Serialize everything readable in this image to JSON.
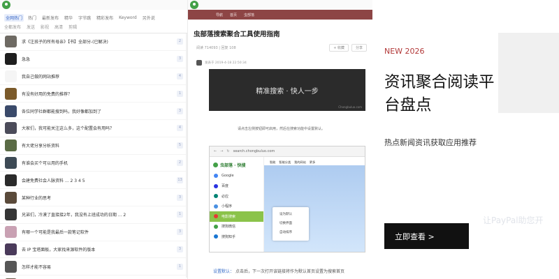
{
  "left_panel": {
    "nav_row1": [
      "全网热门",
      "热门",
      "最新发布",
      "精华",
      "字节跳",
      "精彩发布",
      "Keyword",
      "另外说"
    ],
    "nav_row2": [
      "全都发布",
      "发送",
      "影视",
      "高清",
      "剪辑"
    ],
    "items": [
      {
        "title": "求《注孩子的所有母亲》【书】全部分-(已解决)",
        "count": "2",
        "avatar": "#6e6a63"
      },
      {
        "title": "急急",
        "count": "3",
        "avatar": "#1e1e1e"
      },
      {
        "title": "我自己做的网站推荐",
        "count": "4",
        "avatar": "#f5f5f5"
      },
      {
        "title": "有没有好用的免费的推荐？",
        "count": "1",
        "avatar": "#7b5a2a"
      },
      {
        "title": "各位同学社群都能搜到吗，我好像都加到了",
        "count": "3",
        "avatar": "#3a4a6a"
      },
      {
        "title": "大家们，我可能关注这么多，这个配置会有用吗？",
        "count": "4",
        "avatar": "#4c4c5a"
      },
      {
        "title": "有大佬分享分析资料",
        "count": "5",
        "avatar": "#5a6b45"
      },
      {
        "title": "有谁会买个可以用的手机",
        "count": "2",
        "avatar": "#3d4a55"
      },
      {
        "title": "会建免费社会人脉资料 ... 2 3 4 5",
        "count": "13",
        "avatar": "#2a2a2a"
      },
      {
        "title": "某种行业的思考",
        "count": "3",
        "avatar": "#5a4a3a"
      },
      {
        "title": "兄弟们，冷漠了直接接2年，我没有上班成功的日期 ... 2",
        "count": "1",
        "avatar": "#353535"
      },
      {
        "title": "有哪一个可能是我最后一款笔记软件",
        "count": "3",
        "avatar": "#c9a1b3"
      },
      {
        "title": "去 IP 宝塔面板，大家找来源软件的版本",
        "count": "3",
        "avatar": "#4a3a5a"
      },
      {
        "title": "怎样才能不容易",
        "count": "1",
        "avatar": "#565656"
      },
      {
        "title": "分享一个在免费软件里面的解决搜索服务",
        "count": "2",
        "avatar": "#6a5a4a"
      }
    ]
  },
  "middle_panel": {
    "header_tabs": [
      "导航",
      "首页",
      "虫部落"
    ],
    "article_title": "虫部落搜索聚合工具使用指南",
    "meta_left": "阅读 714093 | 回复 108",
    "meta_buttons": [
      "+ 收藏",
      "分享"
    ],
    "byline": "发表于 2019-4-18 22:50:34",
    "banner_text": "精准搜索 · 快人一步",
    "banner_url": "Chongbuluo.com",
    "caption": "请点击左侧按钮即可启用，然后在搜索功能中设置默认。",
    "browser": {
      "url": "search.chongbuluo.com",
      "brand": "虫部落 · 快搜",
      "bookmarks": [
        "智能",
        "智能分类",
        "我的网站",
        "更多"
      ],
      "engines": [
        {
          "label": "Google",
          "color": "#4285f4"
        },
        {
          "label": "百度",
          "color": "#2932e1"
        },
        {
          "label": "必应",
          "color": "#008373"
        },
        {
          "label": "小程序",
          "color": "#4a90e2"
        },
        {
          "label": "电影搜索",
          "color": "#e53935"
        },
        {
          "label": "搜狗微信",
          "color": "#43a047"
        },
        {
          "label": "搜狗知乎",
          "color": "#1976d2"
        }
      ],
      "menu_items": [
        "设为默认",
        "切换界面",
        "自动排序"
      ]
    },
    "footer_label": "设置默认：",
    "footer_text": "点击后，下一次打开该链接将作为默认首页设置为搜索首页"
  },
  "right_panel": {
    "tag": "NEW 2026",
    "title": "资讯聚合阅读平台盘点",
    "subtitle": "热点新闻资讯获取应用推荐",
    "button_label": "立即查看 >",
    "bg_text": "让PayPal助您开",
    "accent_color": "#b23838"
  }
}
